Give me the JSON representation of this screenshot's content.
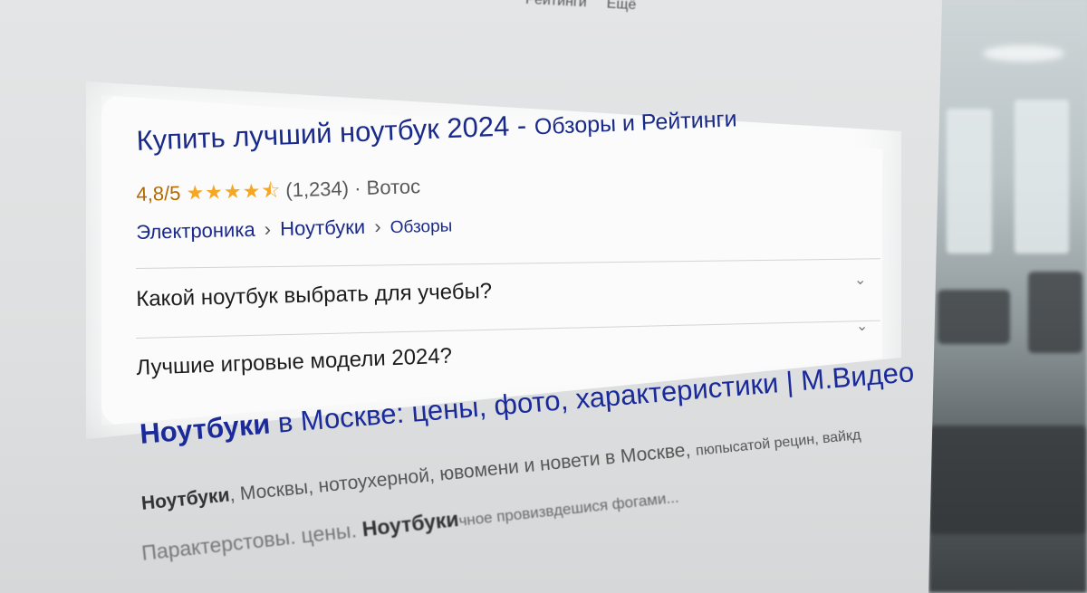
{
  "topnav": {
    "items": [
      "Рейтинги",
      "Ещё"
    ]
  },
  "result1": {
    "title_main": "Купить лучший ноутбук 2024 - ",
    "title_tail": "Обзоры и Рейтинги",
    "rating_score": "4,8/5",
    "stars": "★★★★",
    "half_star": "⯪",
    "reviews": "(1,234)",
    "dot": " · ",
    "source": "Вотос",
    "breadcrumb": [
      "Электроника",
      "Ноутбуки",
      "Обзоры"
    ],
    "breadcrumb_sep": "›",
    "faq": [
      {
        "question": "Какой ноутбук выбрать для учебы?"
      },
      {
        "question": "Лучшие игровые модели 2024?"
      }
    ]
  },
  "result2": {
    "title_bold": "Ноутбуки",
    "title_rest": " в Москве: цены, фото, характеристики | М.Видео",
    "snippet1_bold": "Ноутбуки",
    "snippet1_rest": ", Москвы, нотоухерной, ювомени и новети в Москве, ",
    "snippet1_fade": "пюпысатой рецин, вайкд",
    "snippet2_a": "Парактерстовы. цены. ",
    "snippet2_bold": "Ноутбуки",
    "snippet2_fade": "чное провизвдешися фогами..."
  },
  "colors": {
    "link": "#1a2a8a",
    "star": "#f5a623",
    "rating_score": "#b06a00"
  }
}
